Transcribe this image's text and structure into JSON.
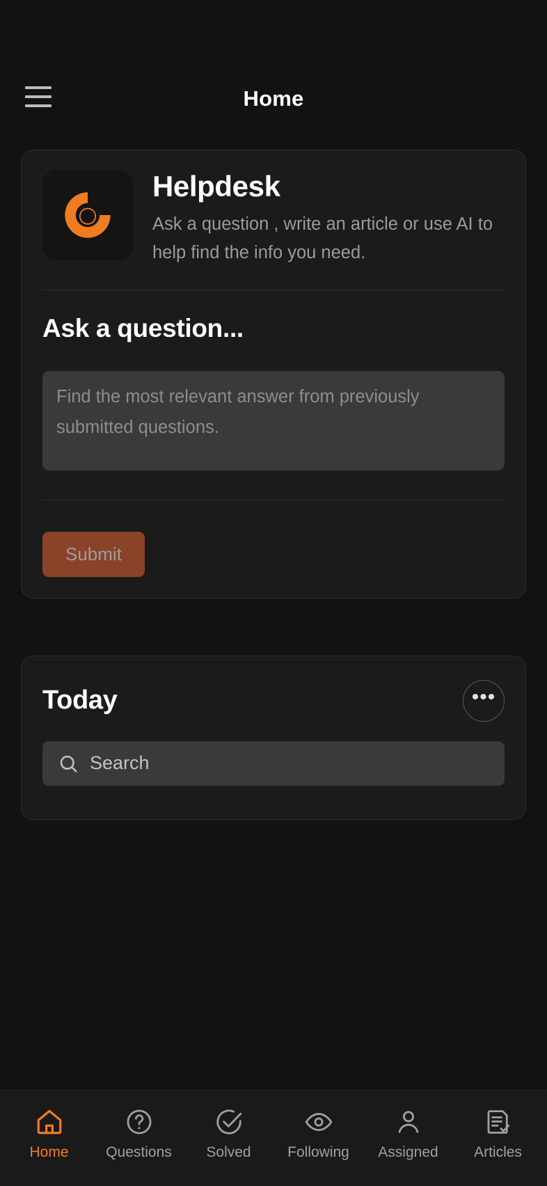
{
  "header": {
    "menu_icon": "hamburger-menu-icon",
    "title": "Home"
  },
  "helpdesk_card": {
    "logo_icon": "helpdesk-ring-logo",
    "title": "Helpdesk",
    "description": "Ask a question , write an article or use AI to help find the info you need.",
    "ask_section_title": "Ask a question...",
    "question_value": "",
    "question_placeholder": "Find the most relevant answer from previously submitted questions.",
    "submit_label": "Submit"
  },
  "today_card": {
    "title": "Today",
    "more_icon": "ellipsis-icon",
    "more_label": "•••",
    "search_icon": "search-icon",
    "search_value": "",
    "search_placeholder": "Search"
  },
  "bottom_nav": {
    "items": [
      {
        "label": "Home",
        "icon": "home-icon",
        "active": true
      },
      {
        "label": "Questions",
        "icon": "question-circle-icon",
        "active": false
      },
      {
        "label": "Solved",
        "icon": "check-circle-icon",
        "active": false
      },
      {
        "label": "Following",
        "icon": "eye-icon",
        "active": false
      },
      {
        "label": "Assigned",
        "icon": "user-icon",
        "active": false
      },
      {
        "label": "Articles",
        "icon": "article-check-icon",
        "active": false
      }
    ]
  },
  "colors": {
    "background": "#121212",
    "card": "#1b1b1b",
    "accent": "#f07c21",
    "submit_bg": "#8a4228",
    "field_bg": "#3a3a3a",
    "muted_text": "#9b9b9b"
  }
}
